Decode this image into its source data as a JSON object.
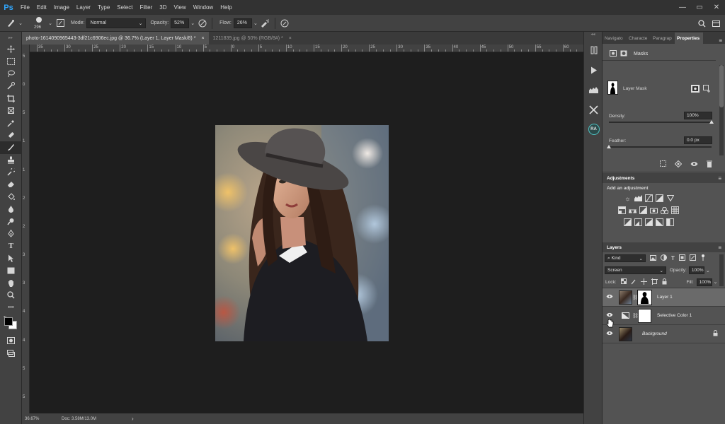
{
  "app": {
    "logo": "Ps"
  },
  "menu": [
    "File",
    "Edit",
    "Image",
    "Layer",
    "Type",
    "Select",
    "Filter",
    "3D",
    "View",
    "Window",
    "Help"
  ],
  "window_controls": {
    "minimize": "—",
    "maximize": "▭",
    "close": "✕"
  },
  "options": {
    "brush_size": "296",
    "mode_label": "Mode:",
    "mode_value": "Normal",
    "opacity_label": "Opacity:",
    "opacity_value": "52%",
    "flow_label": "Flow:",
    "flow_value": "26%"
  },
  "tabs": [
    {
      "label": "photo-1614090965443-3df21c6906ec.jpg @ 36.7% (Layer 1, Layer Mask/8) *",
      "close": "×"
    },
    {
      "label": "1211839.jpg @ 50% (RGB/8#) *",
      "close": "×"
    }
  ],
  "ruler": {
    "top": [
      "35",
      "30",
      "25",
      "20",
      "15",
      "10",
      "5",
      "0",
      "5",
      "10",
      "15",
      "20",
      "25",
      "30",
      "35",
      "40",
      "45",
      "50",
      "55",
      "60"
    ],
    "left": [
      "5",
      "0",
      "5",
      "1",
      "1",
      "2",
      "2",
      "3",
      "3",
      "4",
      "4",
      "5",
      "5"
    ]
  },
  "status": {
    "zoom": "36.67%",
    "doc": "Doc: 3.58M/13.0M",
    "arrow": "›"
  },
  "dock": {
    "ra_label": "RA"
  },
  "properties": {
    "tabs": [
      "Navigato",
      "Characte",
      "Paragrap",
      "Properties"
    ],
    "section": "Masks",
    "mask_label": "Layer Mask",
    "density_label": "Density:",
    "density_value": "100%",
    "density_fraction": 1.0,
    "feather_label": "Feather:",
    "feather_value": "0.0 px",
    "feather_fraction": 0.0
  },
  "adjustments": {
    "title": "Adjustments",
    "subtitle": "Add an adjustment"
  },
  "layers": {
    "title": "Layers",
    "kind_label": "Kind",
    "blend_mode": "Screen",
    "opacity_label": "Opacity:",
    "opacity_value": "100%",
    "lock_label": "Lock:",
    "fill_label": "Fill:",
    "fill_value": "100%",
    "items": [
      {
        "name": "Layer 1",
        "selected": true
      },
      {
        "name": "Selective Color 1",
        "selected": false
      },
      {
        "name": "Background",
        "selected": false
      }
    ]
  }
}
